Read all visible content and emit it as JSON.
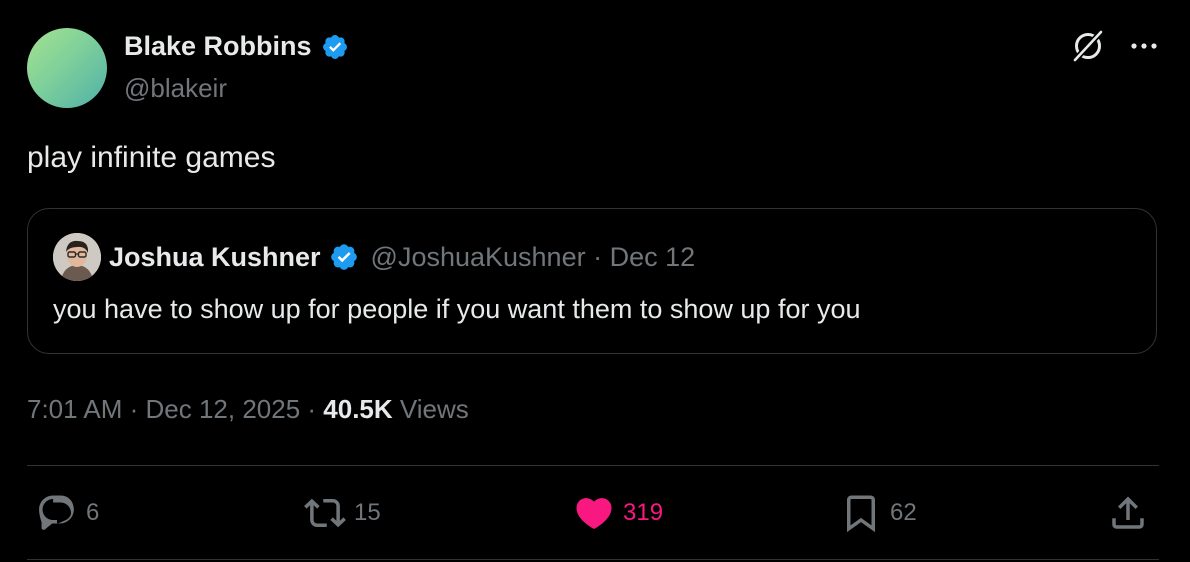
{
  "tweet": {
    "author_name": "Blake Robbins",
    "author_handle": "@blakeir",
    "text": "play infinite games",
    "timestamp": "7:01 AM · Dec 12, 2025 · ",
    "views_count": "40.5K",
    "views_label": "Views"
  },
  "quote": {
    "author_name": "Joshua Kushner",
    "meta": "@JoshuaKushner · Dec 12",
    "text": "you have to show up for people if you want them to show up for you"
  },
  "actions": {
    "replies": "6",
    "reposts": "15",
    "likes": "319",
    "bookmarks": "62"
  },
  "colors": {
    "background": "#000000",
    "text": "#e7e9ea",
    "muted": "#71767b",
    "verified": "#1d9bf0",
    "like": "#f91880",
    "border": "#2f3336"
  },
  "icons": [
    "verified-badge-icon",
    "grok-icon",
    "more-icon",
    "reply-icon",
    "repost-icon",
    "like-icon",
    "bookmark-icon",
    "share-icon"
  ]
}
